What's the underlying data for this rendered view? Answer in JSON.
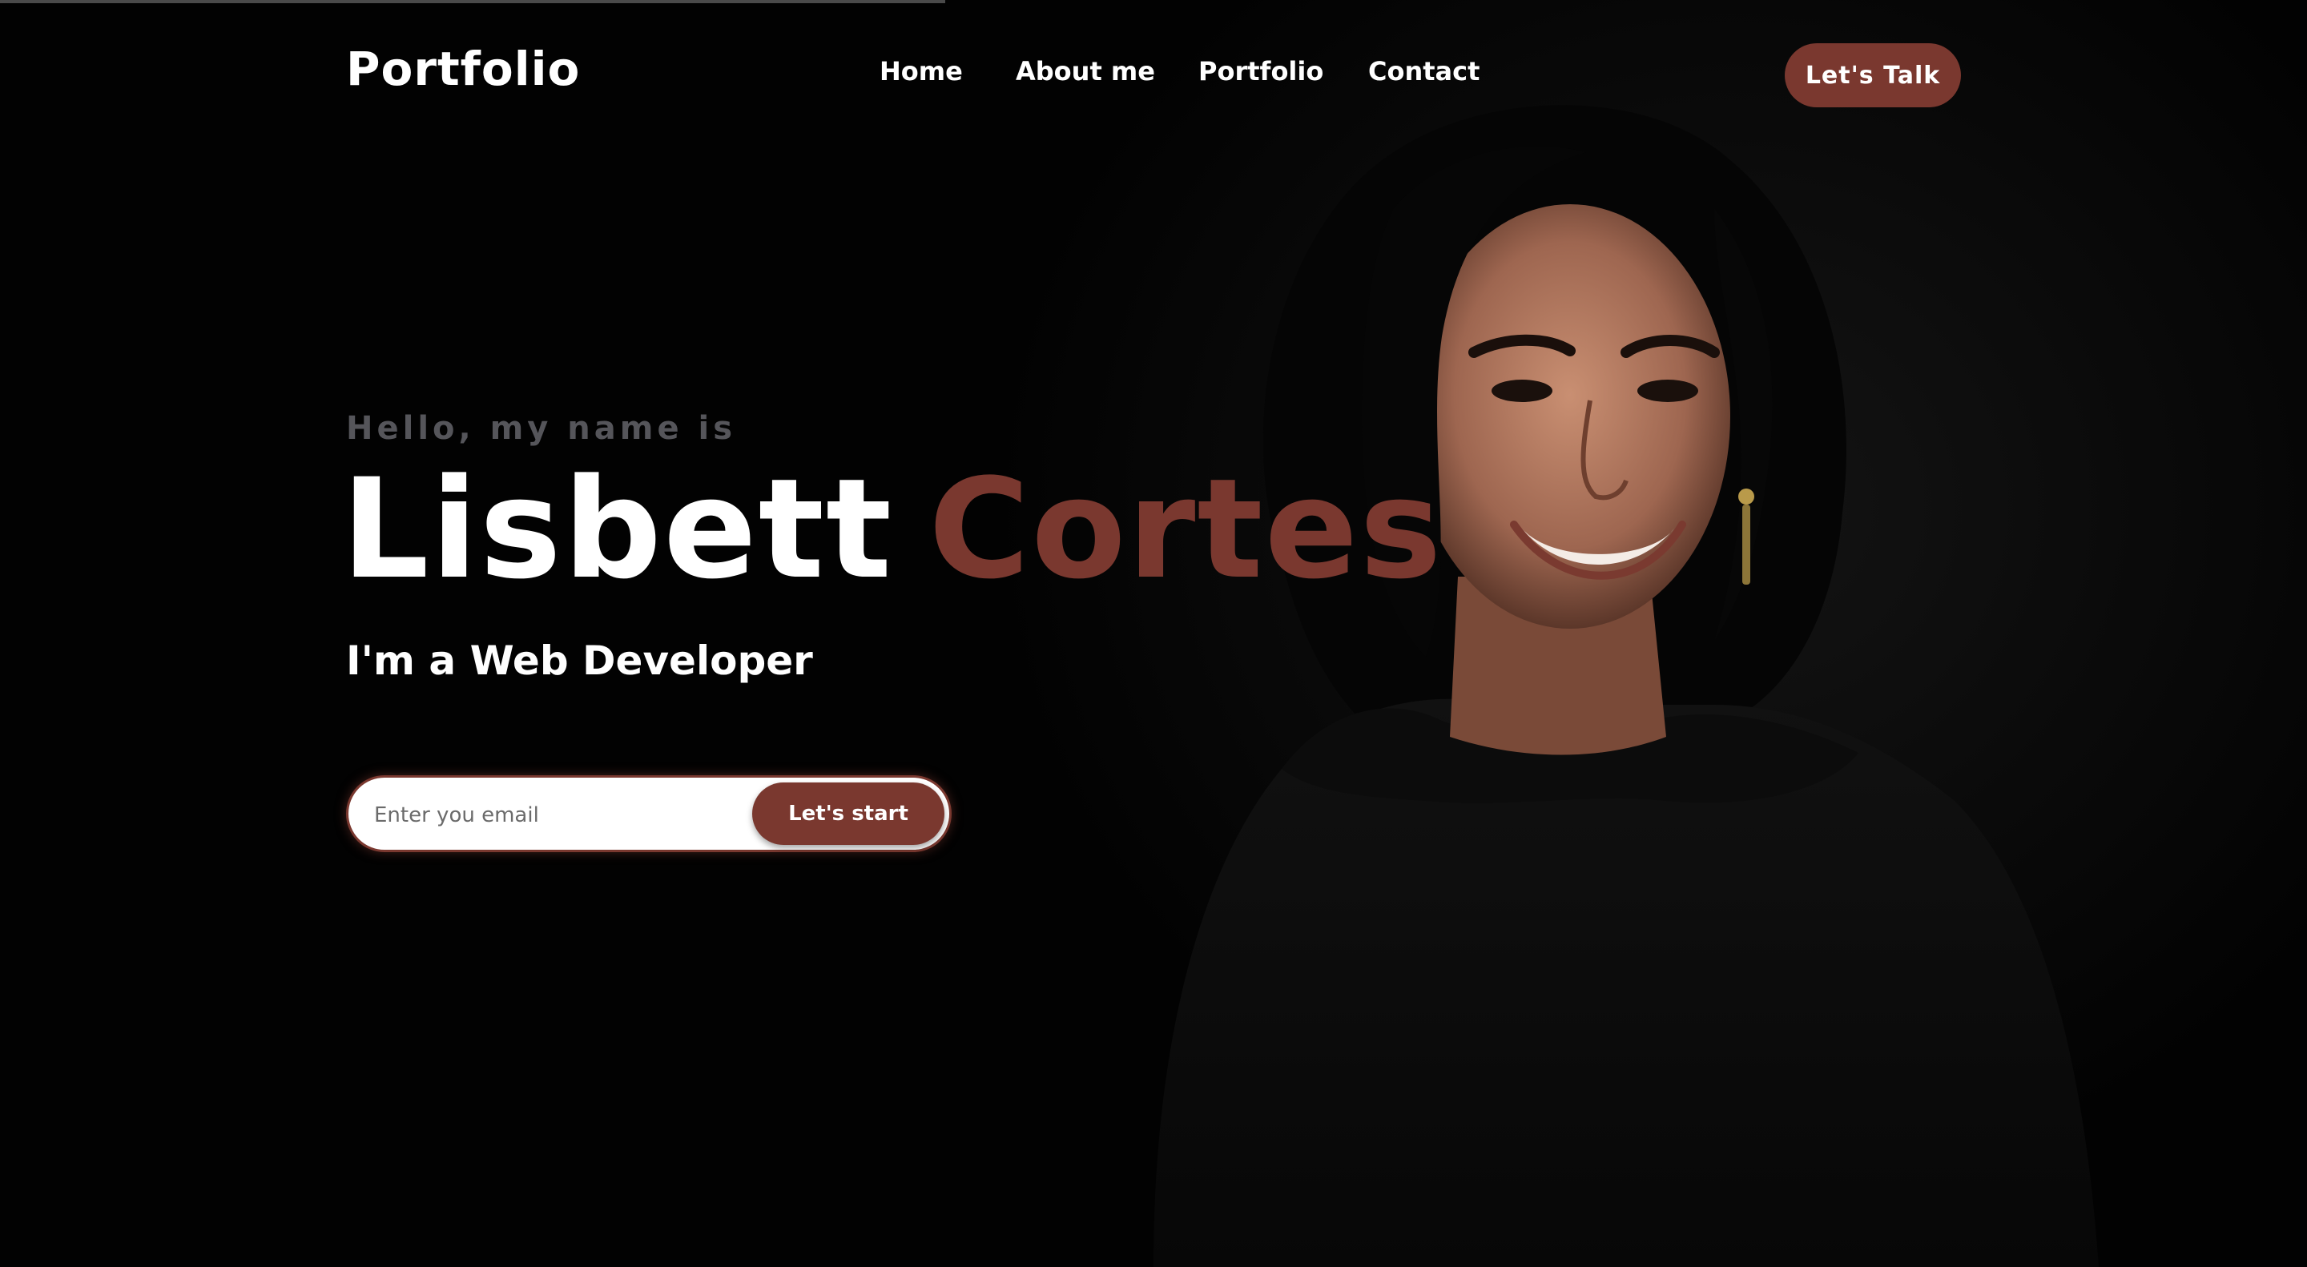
{
  "header": {
    "logo": "Portfolio",
    "nav": [
      {
        "label": "Home"
      },
      {
        "label": "About me"
      },
      {
        "label": "Portfolio"
      },
      {
        "label": "Contact"
      }
    ],
    "cta_label": "Let's Talk"
  },
  "hero": {
    "greeting": "Hello, my name is",
    "first_name": "Lisbett",
    "last_name": "Cortes",
    "role": "I'm a Web Developer"
  },
  "signup": {
    "email_placeholder": "Enter you email",
    "email_value": "",
    "button_label": "Let's start"
  },
  "colors": {
    "background": "#020202",
    "accent": "#7a382f",
    "text": "#ffffff",
    "muted": "#55555a"
  }
}
